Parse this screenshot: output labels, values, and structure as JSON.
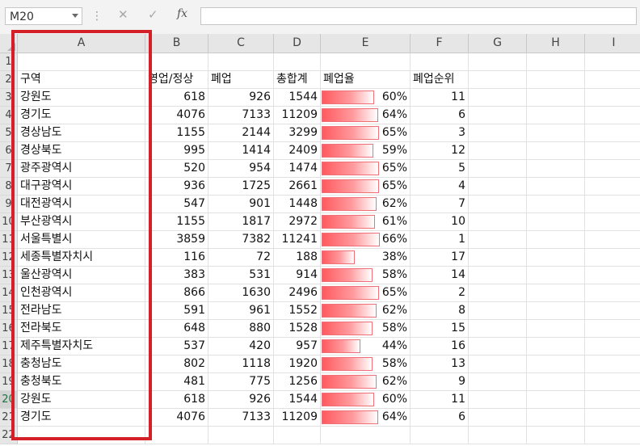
{
  "namebox": {
    "value": "M20"
  },
  "toolbar": {
    "cancel_glyph": "✕",
    "enter_glyph": "✓",
    "fx_glyph": "fx",
    "dots": "⋮"
  },
  "formula_bar": {
    "value": ""
  },
  "columns": [
    "A",
    "B",
    "C",
    "D",
    "E",
    "F",
    "G",
    "H",
    "I"
  ],
  "selected_row": "20",
  "rows": [
    {
      "n": "1",
      "a": "",
      "b": "",
      "c": "",
      "d": "",
      "e": "",
      "f": ""
    },
    {
      "n": "2",
      "a": "구역",
      "b": "영업/정상",
      "c": "폐업",
      "d": "총합계",
      "e": "폐업율",
      "f": "폐업순위"
    },
    {
      "n": "3",
      "a": "강원도",
      "b": "618",
      "c": "926",
      "d": "1544",
      "e": "60%",
      "f": "11",
      "ratio": 0.6
    },
    {
      "n": "4",
      "a": "경기도",
      "b": "4076",
      "c": "7133",
      "d": "11209",
      "e": "64%",
      "f": "6",
      "ratio": 0.64
    },
    {
      "n": "5",
      "a": "경상남도",
      "b": "1155",
      "c": "2144",
      "d": "3299",
      "e": "65%",
      "f": "3",
      "ratio": 0.65
    },
    {
      "n": "6",
      "a": "경상북도",
      "b": "995",
      "c": "1414",
      "d": "2409",
      "e": "59%",
      "f": "12",
      "ratio": 0.59
    },
    {
      "n": "7",
      "a": "광주광역시",
      "b": "520",
      "c": "954",
      "d": "1474",
      "e": "65%",
      "f": "5",
      "ratio": 0.65
    },
    {
      "n": "8",
      "a": "대구광역시",
      "b": "936",
      "c": "1725",
      "d": "2661",
      "e": "65%",
      "f": "4",
      "ratio": 0.65
    },
    {
      "n": "9",
      "a": "대전광역시",
      "b": "547",
      "c": "901",
      "d": "1448",
      "e": "62%",
      "f": "7",
      "ratio": 0.62
    },
    {
      "n": "10",
      "a": "부산광역시",
      "b": "1155",
      "c": "1817",
      "d": "2972",
      "e": "61%",
      "f": "10",
      "ratio": 0.61
    },
    {
      "n": "11",
      "a": "서울특별시",
      "b": "3859",
      "c": "7382",
      "d": "11241",
      "e": "66%",
      "f": "1",
      "ratio": 0.66
    },
    {
      "n": "12",
      "a": "세종특별자치시",
      "b": "116",
      "c": "72",
      "d": "188",
      "e": "38%",
      "f": "17",
      "ratio": 0.38
    },
    {
      "n": "13",
      "a": "울산광역시",
      "b": "383",
      "c": "531",
      "d": "914",
      "e": "58%",
      "f": "14",
      "ratio": 0.58
    },
    {
      "n": "14",
      "a": "인천광역시",
      "b": "866",
      "c": "1630",
      "d": "2496",
      "e": "65%",
      "f": "2",
      "ratio": 0.65
    },
    {
      "n": "15",
      "a": "전라남도",
      "b": "591",
      "c": "961",
      "d": "1552",
      "e": "62%",
      "f": "8",
      "ratio": 0.62
    },
    {
      "n": "16",
      "a": "전라북도",
      "b": "648",
      "c": "880",
      "d": "1528",
      "e": "58%",
      "f": "15",
      "ratio": 0.58
    },
    {
      "n": "17",
      "a": "제주특별자치도",
      "b": "537",
      "c": "420",
      "d": "957",
      "e": "44%",
      "f": "16",
      "ratio": 0.44
    },
    {
      "n": "18",
      "a": "충청남도",
      "b": "802",
      "c": "1118",
      "d": "1920",
      "e": "58%",
      "f": "13",
      "ratio": 0.58
    },
    {
      "n": "19",
      "a": "충청북도",
      "b": "481",
      "c": "775",
      "d": "1256",
      "e": "62%",
      "f": "9",
      "ratio": 0.62
    },
    {
      "n": "20",
      "a": "강원도",
      "b": "618",
      "c": "926",
      "d": "1544",
      "e": "60%",
      "f": "11",
      "ratio": 0.6
    },
    {
      "n": "21",
      "a": "경기도",
      "b": "4076",
      "c": "7133",
      "d": "11209",
      "e": "64%",
      "f": "6",
      "ratio": 0.64
    },
    {
      "n": "22",
      "a": "",
      "b": "",
      "c": "",
      "d": "",
      "e": "",
      "f": ""
    }
  ],
  "colors": {
    "highlight_box": "#d42027",
    "databar": "#ff5a5f",
    "selected_row_text": "#217346"
  }
}
